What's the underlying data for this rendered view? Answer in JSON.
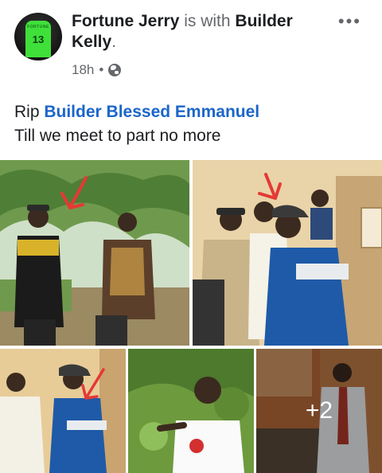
{
  "post": {
    "author": "Fortune Jerry",
    "with_text": "is with",
    "tagged_friend": "Builder",
    "tagged_friend_line2": "Kelly",
    "period": ".",
    "time": "18h",
    "separator": "•",
    "privacy_icon": "globe-icon",
    "more_label": "•••",
    "avatar_number": "13",
    "avatar_name": "FORTUNE"
  },
  "message": {
    "prefix": "Rip",
    "mention": "Builder Blessed Emmanuel",
    "line2": "Till we meet to part no more"
  },
  "photos": {
    "extra_count": "+2"
  },
  "colors": {
    "link": "#1b66c9",
    "secondary": "#65676b",
    "arrow": "#e53935"
  }
}
